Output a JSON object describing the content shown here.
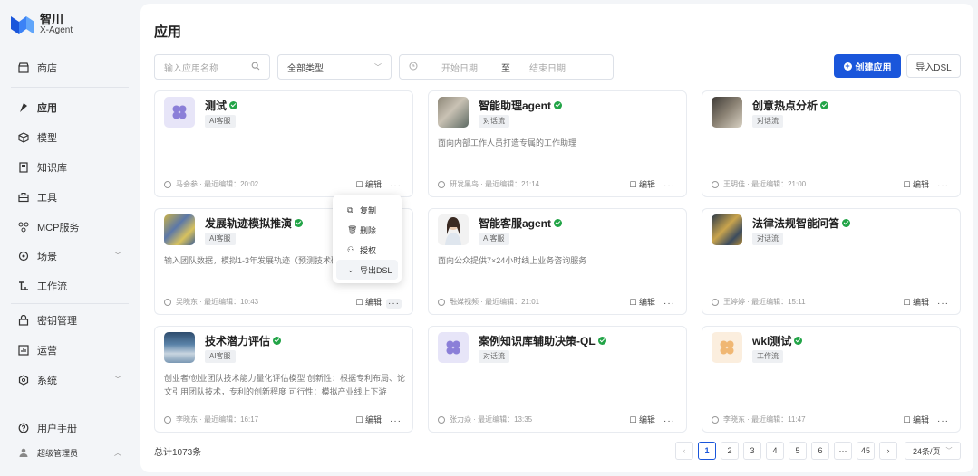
{
  "brand": {
    "name": "智川",
    "sub": "X-Agent"
  },
  "nav": [
    {
      "label": "商店",
      "icon": "store-icon"
    },
    {
      "label": "应用",
      "icon": "app-icon"
    },
    {
      "label": "模型",
      "icon": "cube-icon"
    },
    {
      "label": "知识库",
      "icon": "book-icon"
    },
    {
      "label": "工具",
      "icon": "toolbox-icon"
    },
    {
      "label": "MCP服务",
      "icon": "mcp-icon"
    },
    {
      "label": "场景",
      "icon": "scene-icon"
    },
    {
      "label": "工作流",
      "icon": "workflow-icon"
    },
    {
      "label": "密钥管理",
      "icon": "key-icon"
    },
    {
      "label": "运营",
      "icon": "chart-icon"
    },
    {
      "label": "系统",
      "icon": "settings-icon"
    },
    {
      "label": "用户手册",
      "icon": "help-icon"
    },
    {
      "label": "超级管理员",
      "icon": "user-icon"
    }
  ],
  "page": {
    "title": "应用"
  },
  "filters": {
    "search_placeholder": "输入应用名称",
    "type_value": "全部类型",
    "start_date": "开始日期",
    "sep": "至",
    "end_date": "结束日期"
  },
  "actions": {
    "create": "创建应用",
    "import": "导入DSL"
  },
  "cards": [
    {
      "name": "测试",
      "tag": "AI客服",
      "desc": "",
      "author": "马会参",
      "time": "最近编辑：20:02"
    },
    {
      "name": "智能助理agent",
      "tag": "对话流",
      "desc": "面向内部工作人员打造专属的工作助理",
      "author": "研发黑鸟",
      "time": "最近编辑：21:14"
    },
    {
      "name": "创意热点分析",
      "tag": "对话流",
      "desc": "",
      "author": "王玥佳",
      "time": "最近编辑：21:00"
    },
    {
      "name": "发展轨迹模拟推演",
      "tag": "AI客服",
      "desc": "输入团队数据，模拟1-3年发展轨迹（预测技术研",
      "author": "吴晓东",
      "time": "最近编辑：10:43"
    },
    {
      "name": "智能客服agent",
      "tag": "AI客服",
      "desc": "面向公众提供7×24小时线上业务咨询服务",
      "author": "融媒视频",
      "time": "最近编辑：21:01"
    },
    {
      "name": "法律法规智能问答",
      "tag": "对话流",
      "desc": "",
      "author": "王婷婷",
      "time": "最近编辑：15:11"
    },
    {
      "name": "技术潜力评估",
      "tag": "AI客服",
      "desc": "创业者/创业团队技术能力量化评估模型 创新性：根据专利布局、论文引用团队技术，专利的创新程度 可行性：模拟产业线上下游",
      "author": "李晓东",
      "time": "最近编辑：16:17"
    },
    {
      "name": "案例知识库辅助决策-QL",
      "tag": "对话流",
      "desc": "",
      "author": "张力焱",
      "time": "最近编辑：13:35"
    },
    {
      "name": "wkl测试",
      "tag": "工作流",
      "desc": "",
      "author": "李晓东",
      "time": "最近编辑：11:47"
    }
  ],
  "card_edit": "编辑",
  "menu": [
    {
      "label": "复制",
      "icon": "copy-icon"
    },
    {
      "label": "删除",
      "icon": "trash-icon"
    },
    {
      "label": "授权",
      "icon": "authorize-icon"
    },
    {
      "label": "导出DSL",
      "icon": "export-icon"
    }
  ],
  "footer": {
    "total": "总计1073条",
    "pages": [
      "1",
      "2",
      "3",
      "4",
      "5",
      "6",
      "···",
      "45"
    ],
    "page_size": "24条/页"
  },
  "colors": {
    "primary": "#1a56db",
    "ok": "#22a447"
  }
}
